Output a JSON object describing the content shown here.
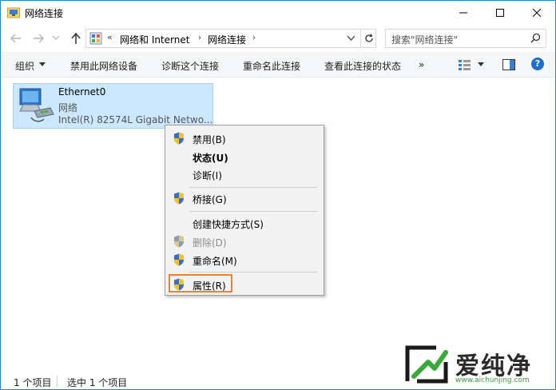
{
  "window": {
    "title": "网络连接",
    "controls": {
      "minimize": "minimize",
      "maximize": "maximize",
      "close": "close"
    }
  },
  "address": {
    "overflow": "«",
    "crumbs": [
      "网络和 Internet",
      "网络连接"
    ],
    "separator": "›"
  },
  "search": {
    "placeholder": "搜索\"网络连接\""
  },
  "toolbar": {
    "organize": "组织",
    "disable_device": "禁用此网络设备",
    "diagnose": "诊断这个连接",
    "rename": "重命名此连接",
    "view_status": "查看此连接的状态",
    "more": "»",
    "help": "?"
  },
  "connection": {
    "name": "Ethernet0",
    "network": "网络",
    "device": "Intel(R) 82574L Gigabit Netwo..."
  },
  "context_menu": {
    "items": [
      {
        "label": "禁用(B)",
        "shield": true
      },
      {
        "label": "状态(U)",
        "bold": true
      },
      {
        "label": "诊断(I)"
      },
      {
        "label": "桥接(G)",
        "shield": true
      },
      {
        "label": "创建快捷方式(S)"
      },
      {
        "label": "删除(D)",
        "shield": true,
        "disabled": true
      },
      {
        "label": "重命名(M)",
        "shield": true
      },
      {
        "label": "属性(R)",
        "shield": true,
        "highlighted": true
      }
    ]
  },
  "status_bar": {
    "count": "1 个项目",
    "selected": "选中 1 个项目"
  },
  "watermark": {
    "text": "爱纯净",
    "url": "www.aichunjing.com"
  },
  "colors": {
    "selection_bg": "#cce8ff",
    "selection_border": "#99d1ff",
    "highlight_box": "#e8832b",
    "help_blue": "#1f6fc6"
  }
}
